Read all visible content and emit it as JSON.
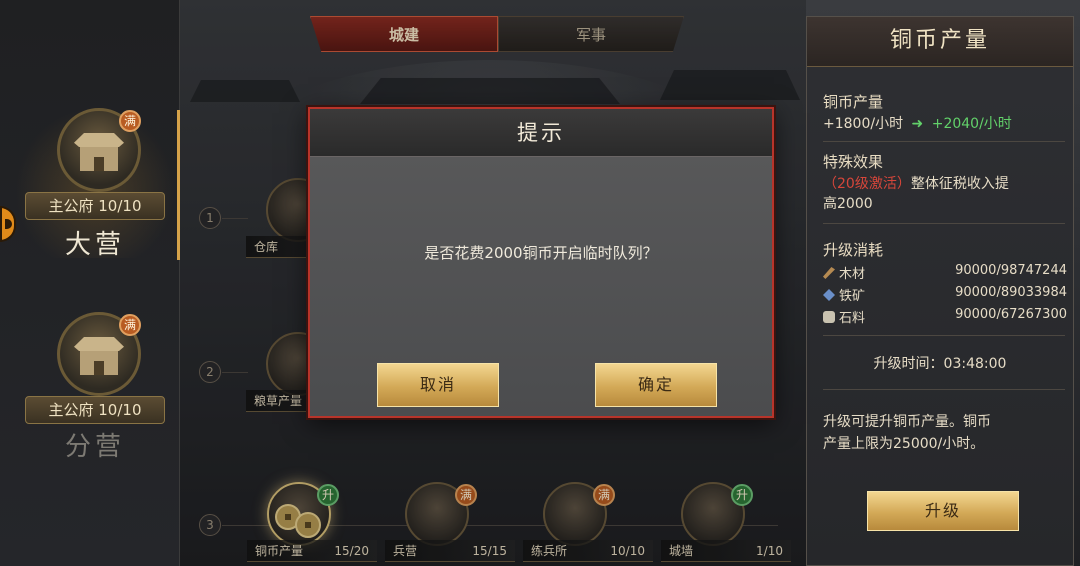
{
  "tabs": [
    {
      "label": "城建"
    },
    {
      "label": "军事"
    }
  ],
  "camps": [
    {
      "badge": "满",
      "level_label": "主公府 10/10",
      "name": "大营"
    },
    {
      "badge": "满",
      "level_label": "主公府 10/10",
      "name": "分营"
    }
  ],
  "rows": [
    {
      "num": "1",
      "buildings": [
        {
          "name": "仓库",
          "level": ""
        }
      ]
    },
    {
      "num": "2",
      "buildings": [
        {
          "name": "粮草产量",
          "level": ""
        }
      ]
    },
    {
      "num": "3",
      "buildings": [
        {
          "name": "铜币产量",
          "level": "15/20",
          "badge": "升"
        },
        {
          "name": "兵营",
          "level": "15/15",
          "badge": "满"
        },
        {
          "name": "练兵所",
          "level": "10/10",
          "badge": "满"
        },
        {
          "name": "城墙",
          "level": "1/10",
          "badge": "升"
        }
      ]
    }
  ],
  "panel": {
    "title": "铜币产量",
    "output_label": "铜币产量",
    "output_current": "+1800/小时",
    "output_arrow": "➜",
    "output_next": "+2040/小时",
    "effect_label": "特殊效果",
    "effect_condition": "（20级激活）",
    "effect_text_1": "整体征税收入提",
    "effect_text_2": "高2000",
    "cost_label": "升级消耗",
    "costs": [
      {
        "name": "木材",
        "value": "90000/98747244",
        "icon_color": "#b58a52"
      },
      {
        "name": "铁矿",
        "value": "90000/89033984",
        "icon_color": "#6a8fc9"
      },
      {
        "name": "石料",
        "value": "90000/67267300",
        "icon_color": "#c9c2b0"
      }
    ],
    "time_label": "升级时间：",
    "time_value": "03:48:00",
    "desc_1": "升级可提升铜币产量。铜币",
    "desc_2": "产量上限为25000/小时。",
    "upgrade_label": "升级"
  },
  "dialog": {
    "title": "提示",
    "message": "是否花费2000铜币开启临时队列？",
    "cancel_label": "取消",
    "confirm_label": "确定"
  }
}
